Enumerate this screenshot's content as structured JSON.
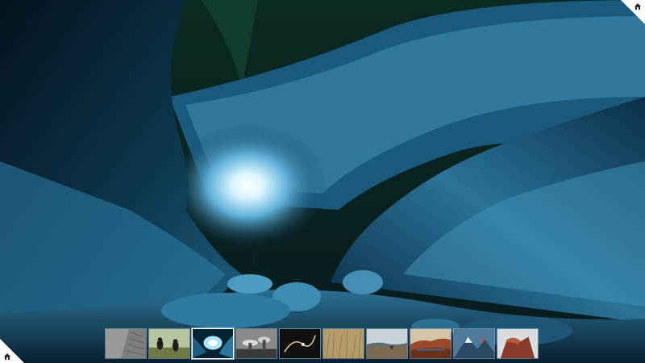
{
  "page": {
    "background": "#041018"
  },
  "hero": {
    "subject": "ice-cave-night"
  },
  "controls": {
    "corner_top_right_icon": "home-icon",
    "corner_bottom_left_icon": "home-icon",
    "corner_color": "#ffffff"
  },
  "thumbnails": {
    "count": 10,
    "active_index": 2,
    "items": [
      {
        "subject": "gray-building-facade"
      },
      {
        "subject": "puffins-on-cliff"
      },
      {
        "subject": "ice-cave"
      },
      {
        "subject": "mushroom-rocks-bw"
      },
      {
        "subject": "dark-light-trail"
      },
      {
        "subject": "golden-grass"
      },
      {
        "subject": "coastal-landscape"
      },
      {
        "subject": "red-hills"
      },
      {
        "subject": "blue-mountain-climber"
      },
      {
        "subject": "red-rock-formation"
      }
    ]
  }
}
